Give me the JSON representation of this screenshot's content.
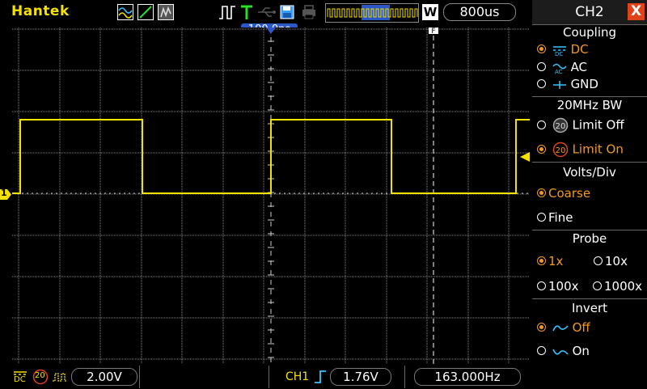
{
  "header": {
    "brand": "Hantek",
    "timebase": "800us",
    "zoom_badge": "W",
    "trigger_position": "100.0ps"
  },
  "panel": {
    "title": "CH2",
    "close_glyph": "X",
    "coupling": {
      "title": "Coupling",
      "options": [
        "DC",
        "AC",
        "GND"
      ],
      "selected": "DC"
    },
    "bandwidth": {
      "title": "20MHz BW",
      "options": [
        "Limit Off",
        "Limit On"
      ],
      "selected": "Limit On"
    },
    "volts_div": {
      "title": "Volts/Div",
      "options": [
        "Coarse",
        "Fine"
      ],
      "selected": "Coarse"
    },
    "probe": {
      "title": "Probe",
      "options": [
        "1x",
        "10x",
        "100x",
        "1000x"
      ],
      "selected": "1x"
    },
    "invert": {
      "title": "Invert",
      "options": [
        "Off",
        "On"
      ],
      "selected": "Off"
    }
  },
  "status": {
    "coupling_glyph": "DC",
    "bw_glyph": "20",
    "ch_scale": "2.00V",
    "trigger_source": "CH1",
    "trigger_level": "1.76V",
    "frequency": "163.000Hz"
  },
  "markers": {
    "ch1": "1"
  },
  "colors": {
    "trace": "#f5e100",
    "grid": "#9a9a9a",
    "accent": "#f29a1d",
    "badge": "#2a58c8",
    "close": "#e0421a"
  }
}
